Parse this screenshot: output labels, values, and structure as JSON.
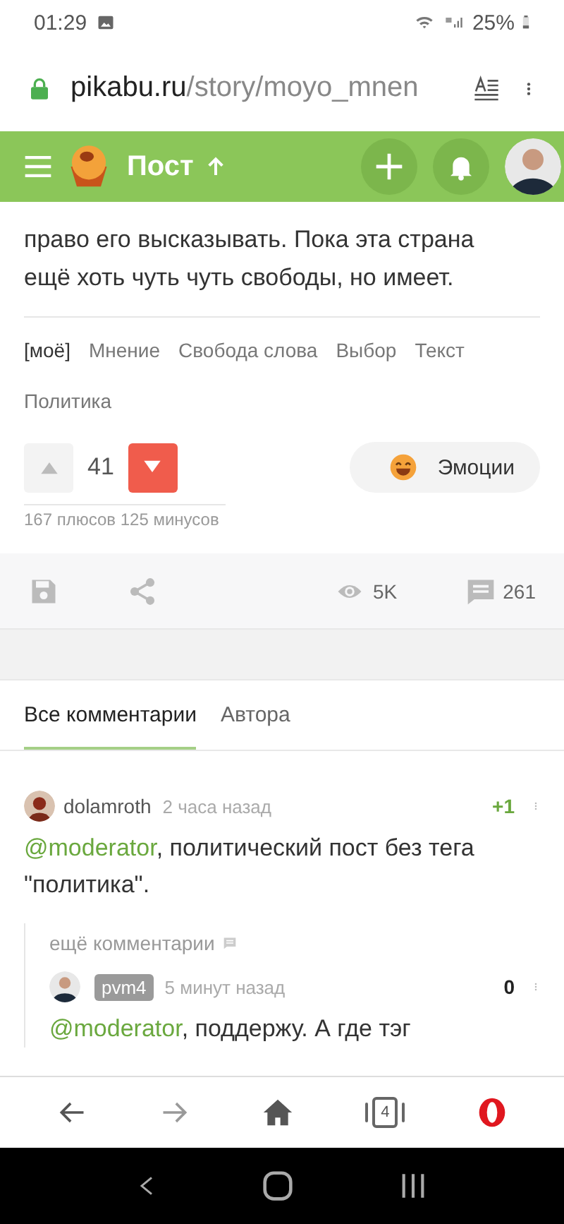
{
  "status_bar": {
    "time": "01:29",
    "battery": "25%"
  },
  "address_bar": {
    "domain": "pikabu.ru",
    "path": "/story/moyo_mnen"
  },
  "header": {
    "title": "Пост"
  },
  "post": {
    "text": "право его высказывать. Пока эта страна ещё хоть чуть чуть свободы, но имеет.",
    "tags": [
      "[моё]",
      "Мнение",
      "Свобода слова",
      "Выбор",
      "Текст",
      "Политика"
    ],
    "upvote": {
      "selected": false
    },
    "rating": "41",
    "downvote": {
      "selected": true
    },
    "emotions_button": "Эмоции",
    "vote_summary": "167 плюсов 125 минусов",
    "views": "5K",
    "comment_count": "261"
  },
  "comment_tabs": [
    {
      "label": "Все комментарии",
      "selected": true
    },
    {
      "label": "Автора",
      "selected": false
    }
  ],
  "comments": [
    {
      "author": "dolamroth",
      "post_author": false,
      "time": "2 часа назад",
      "rating": "+1",
      "positive": true,
      "mention": "@moderator",
      "text": ", политический пост без тега \"политика\".",
      "more_link": "ещё комментарии",
      "replies": [
        {
          "author": "pvm4",
          "post_author": true,
          "time": "5 минут назад",
          "rating": "0",
          "positive": false,
          "mention": "@moderator",
          "text": ", поддержу. А где тэг"
        }
      ]
    }
  ],
  "browser_bar": {
    "tab_count": "4"
  }
}
